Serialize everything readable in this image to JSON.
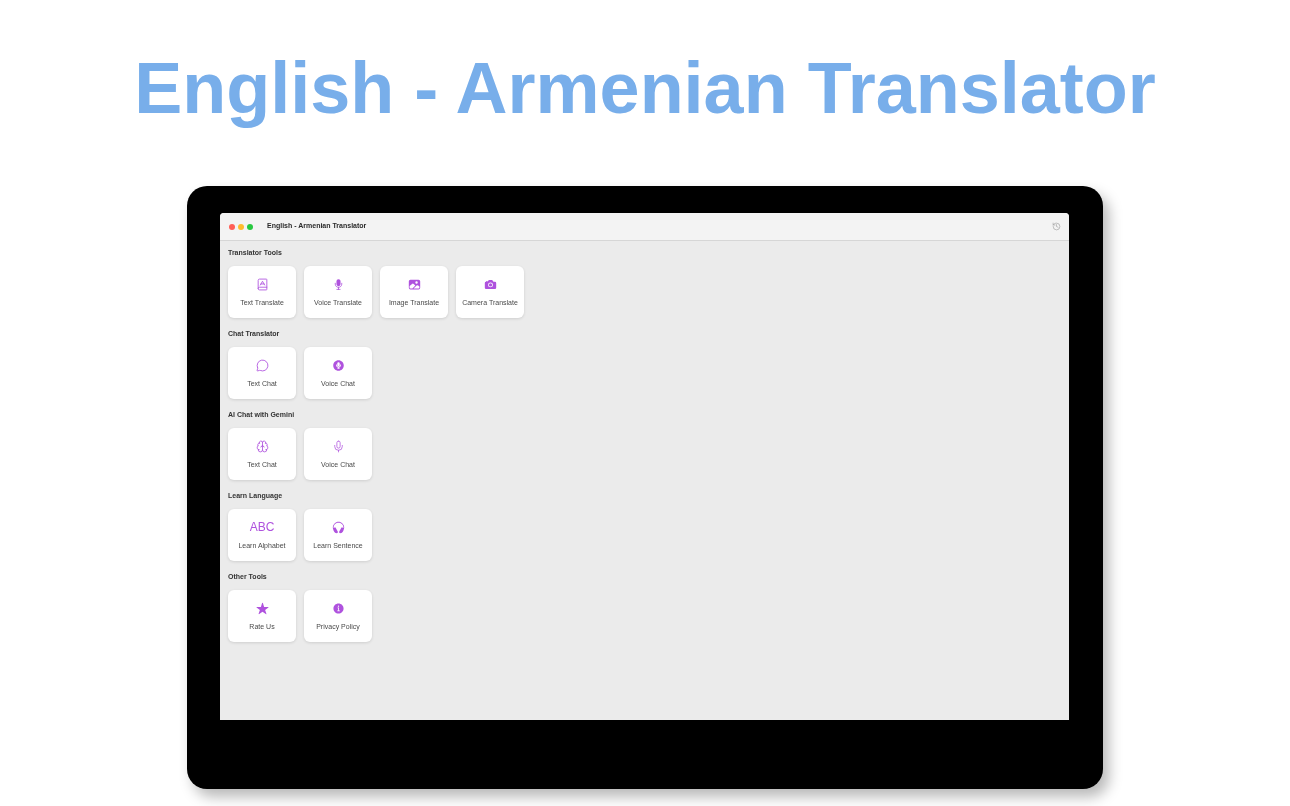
{
  "headline": "English - Armenian Translator",
  "window": {
    "title": "English - Armenian Translator"
  },
  "sections": [
    {
      "title": "Translator Tools",
      "tools": [
        {
          "kind": "icon",
          "label": "Text Translate"
        },
        {
          "kind": "icon",
          "label": "Voice Translate"
        },
        {
          "kind": "icon",
          "label": "Image Translate"
        },
        {
          "kind": "icon",
          "label": "Camera Translate"
        }
      ]
    },
    {
      "title": "Chat Translator",
      "tools": [
        {
          "kind": "icon",
          "label": "Text Chat"
        },
        {
          "kind": "icon",
          "label": "Voice Chat"
        }
      ]
    },
    {
      "title": "AI Chat with Gemini",
      "tools": [
        {
          "kind": "icon",
          "label": "Text Chat"
        },
        {
          "kind": "icon",
          "label": "Voice Chat"
        }
      ]
    },
    {
      "title": "Learn Language",
      "tools": [
        {
          "kind": "glyph",
          "glyph": "ABC",
          "label": "Learn Alphabet"
        },
        {
          "kind": "icon",
          "label": "Learn Sentence"
        }
      ]
    },
    {
      "title": "Other Tools",
      "tools": [
        {
          "kind": "icon",
          "label": "Rate Us"
        },
        {
          "kind": "icon",
          "label": "Privacy Policy"
        }
      ]
    }
  ]
}
